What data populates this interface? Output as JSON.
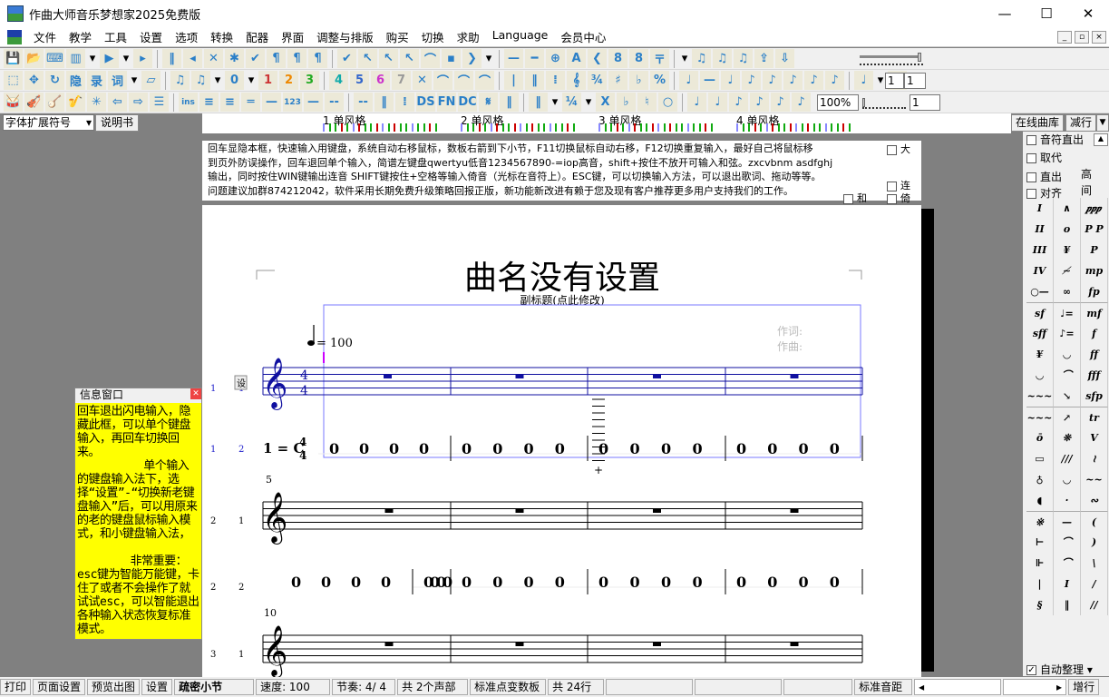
{
  "window": {
    "title": "作曲大师音乐梦想家2025免费版",
    "minimize": "—",
    "maximize": "☐",
    "close": "✕"
  },
  "menu": [
    "文件",
    "教学",
    "工具",
    "设置",
    "选项",
    "转换",
    "配器",
    "界面",
    "调整与排版",
    "购买",
    "切换",
    "求助",
    "Language",
    "会员中心"
  ],
  "toolbar1": [
    "💾",
    "📂",
    "⌨",
    "▥",
    "▾",
    "▶",
    "▾",
    "▸",
    "‖",
    "◂",
    "✕",
    "✱",
    "✔",
    "¶",
    "¶",
    "¶",
    "✔",
    "↖",
    "↖",
    "↖",
    "⌒",
    "▪",
    "❯",
    "▾",
    "—",
    "━",
    "⊕",
    "A",
    "❮",
    "8",
    "8",
    "〒",
    "▾",
    "♫",
    "♫",
    "♫",
    "⇪",
    "⇩"
  ],
  "toolbar2": [
    "⬚",
    "✥",
    "↻",
    "隐",
    "录",
    "词",
    "▾",
    "▱",
    "♫",
    "♫",
    "▾",
    "0",
    "▾",
    "1",
    "2",
    "3",
    "4",
    "5",
    "6",
    "7",
    "✕",
    "⌒",
    "⌒",
    "⌒",
    "|",
    "‖",
    "⁞",
    "𝄞",
    "¾",
    "♯",
    "♭",
    "%",
    "♩",
    "—",
    "♩",
    "♪",
    "♪",
    "♪",
    "♪",
    "♪",
    "♩",
    "▾",
    "⊣"
  ],
  "toolbar3": [
    "🥁",
    "🎻",
    "🪕",
    "🎷",
    "✳",
    "⇦",
    "⇨",
    "☰",
    "ins",
    "≡",
    "≡",
    "═",
    "—",
    "123",
    "—",
    "--",
    "--",
    "‖",
    "⁞",
    "DS",
    "FN",
    "DC",
    "𝄋",
    "‖",
    "‖",
    "▾",
    "¼",
    "▾",
    "X",
    "♭",
    "♮",
    "○",
    "♩",
    "♩",
    "♪",
    "♪",
    "♪",
    "♪"
  ],
  "toolbar2_fields": {
    "a": "1",
    "b": "1"
  },
  "toolbar3_fields": {
    "zoom": "100%",
    "value": "1"
  },
  "font_select": "字体扩展符号",
  "manual_button": "说明书",
  "ruler": {
    "labels": [
      "1 单风格",
      "2 单风格",
      "3 单风格",
      "4 单风格"
    ]
  },
  "right_top": {
    "online_library": "在线曲库",
    "reduce_rows": "减行",
    "note_direct": "音符直出",
    "replace": "取代",
    "direct_out": "直出",
    "align": "对齐",
    "high": "高",
    "gap": "间",
    "auto_arrange": "自动整理"
  },
  "help": {
    "lines": [
      "回车显隐本框，快速输入用键盘，系统自动右移鼠标，数板右箭到下小节，F11切换鼠标自动右移，F12切换重复输入，最好自己将鼠标移",
      "到页外防误操作，回车退回单个输入，简谱左键盘qwertyu低音1234567890-=iop高音，shift+按住不放开可输入和弦。zxcvbnm  asdfghj",
      "输出，同时按住WIN键输出连音 SHIFT键按住+空格等输入倚音（光标在音符上）。ESC键，可以切换输入方法，可以退出歌词、拖动等等。",
      "问题建议加群874212042，软件采用长期免费升级策略回报正版，新功能新改进有赖于您及现有客户推荐更多用户支持我们的工作。"
    ],
    "cb_big": "大",
    "cb_lyric": "连",
    "cb_chord": "和",
    "cb_grace": "倚"
  },
  "score": {
    "title": "曲名没有设置",
    "subtitle": "副标题(点此修改)",
    "tempo": "= 100",
    "lyricist": "作词:",
    "composer": "作曲:",
    "time_top": "4",
    "time_bottom": "4",
    "key": "1 = C",
    "set_button": "设",
    "row_labels": [
      [
        "1",
        "1"
      ],
      [
        "1",
        "2"
      ],
      [
        "2",
        "1"
      ],
      [
        "2",
        "2"
      ],
      [
        "3",
        "1"
      ]
    ],
    "measure_numbers": [
      "5",
      "10"
    ],
    "jianpu_rest": "0",
    "ledger_plus": "+"
  },
  "palette": [
    "I",
    "∧",
    "𝆏𝆏𝆏",
    "II",
    "o",
    "P P",
    "III",
    "¥",
    "P",
    "IV",
    "≁",
    "mp",
    "○—",
    "∞",
    "fp",
    "sf",
    "♩=",
    "mf",
    "sff",
    "♪=",
    "f",
    "¥",
    "◡",
    "ff",
    "◡",
    "⌒",
    "fff",
    "~~~",
    "↘",
    "sfp",
    "~~~",
    "↗",
    "tr",
    "ō",
    "❊",
    "V",
    "▭",
    "///",
    "≀",
    "♁",
    "◡",
    "~~",
    "◖",
    "·",
    "∾",
    "※",
    "—",
    "(",
    "⊢",
    "⌒",
    ")",
    "⊩",
    "⌒",
    "\\",
    "|",
    "I",
    "/",
    "§",
    "‖",
    "//"
  ],
  "info": {
    "title": "信息窗口",
    "text": "回车退出闪电输入，隐藏此框，可以单个键盘输入，再回车切换回来。\n          单个输入的键盘输入法下，选择“设置”-“切换新老键盘输入”后，可以用原来的老的键盘鼠标输入模式，和小键盘输入法，\n\n        非常重要：esc键为智能万能键，卡住了或者不会操作了就试试esc，可以智能退出各种输入状态恢复标准模式。"
  },
  "status": {
    "print": "打印",
    "page_setup": "页面设置",
    "preview": "预览出图",
    "settings": "设置",
    "dense": "疏密小节",
    "speed": "速度: 100",
    "meter": "节奏: 4/ 4",
    "parts": "共 2个声部",
    "keypad": "标准点变数板",
    "rows": "共 24行",
    "spacing": "标准音距",
    "add_row": "增行"
  }
}
